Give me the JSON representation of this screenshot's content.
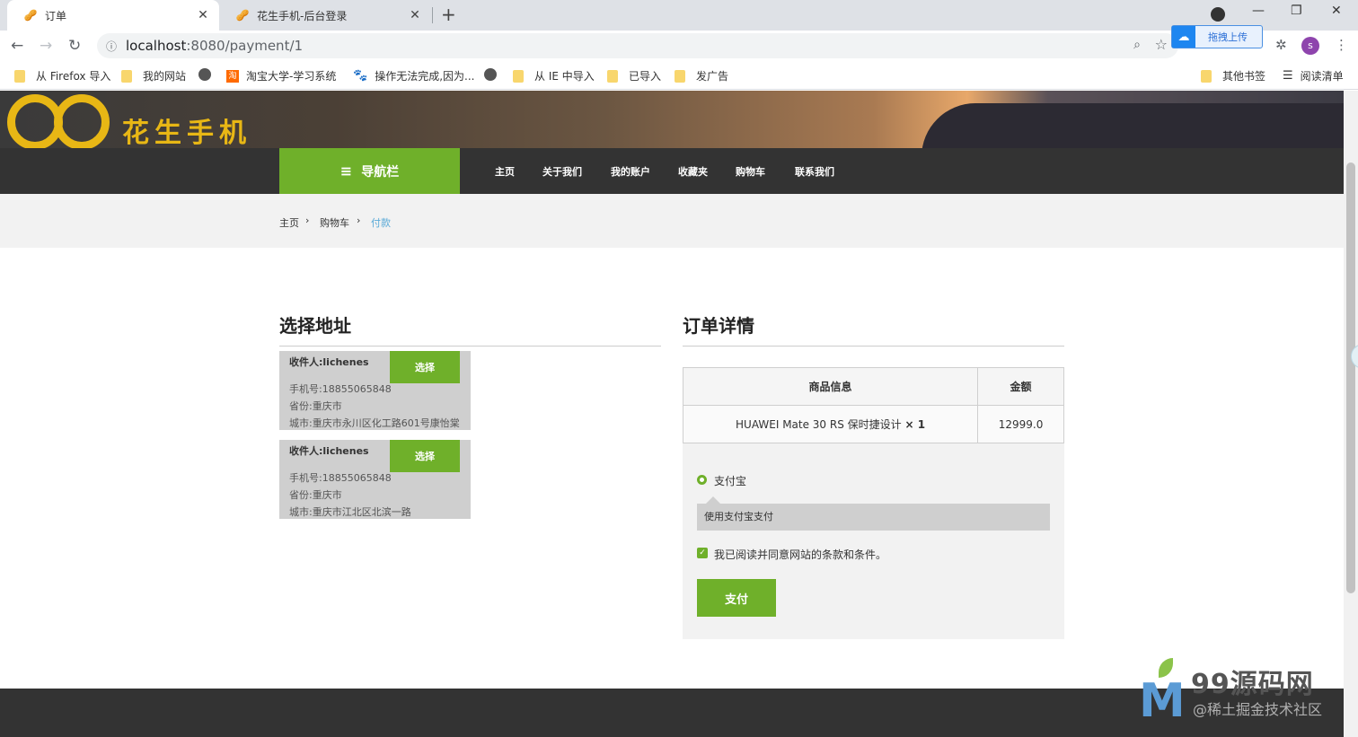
{
  "browser": {
    "tabs": [
      {
        "title": "订单",
        "active": true,
        "favicon": "peanut-favicon-icon"
      },
      {
        "title": "花生手机-后台登录",
        "active": false,
        "favicon": "peanut-favicon-icon"
      }
    ],
    "url_host": "localhost",
    "url_rest": ":8080/payment/1",
    "extension_badge": "拖拽上传",
    "profile_initial": "s",
    "bookmarks": [
      {
        "label": "从 Firefox 导入",
        "icon": "folder-icon"
      },
      {
        "label": "我的网站",
        "icon": "folder-icon"
      },
      {
        "label": "",
        "icon": "globe-icon"
      },
      {
        "label": "淘宝大学-学习系统",
        "icon": "taobao-icon"
      },
      {
        "label": "操作无法完成,因为...",
        "icon": "baidu-icon"
      },
      {
        "label": "",
        "icon": "globe-icon"
      },
      {
        "label": "从 IE 中导入",
        "icon": "folder-icon"
      },
      {
        "label": "已导入",
        "icon": "folder-icon"
      },
      {
        "label": "发广告",
        "icon": "folder-icon"
      }
    ],
    "other_bookmarks": "其他书签",
    "reading_list": "阅读清单"
  },
  "site": {
    "logo_text": "花生手机",
    "nav": {
      "category_label": "导航栏",
      "links": [
        "主页",
        "关于我们",
        "我的账户",
        "收藏夹",
        "购物车",
        "联系我们"
      ]
    },
    "breadcrumb": [
      "主页",
      "购物车",
      "付款"
    ]
  },
  "address": {
    "title": "选择地址",
    "select_label": "选择",
    "cards": [
      {
        "name": "收件人:lichenes",
        "phone": "手机号:18855065848",
        "province": "省份:重庆市",
        "city": "城市:重庆市永川区化工路601号康怡棠"
      },
      {
        "name": "收件人:lichenes",
        "phone": "手机号:18855065848",
        "province": "省份:重庆市",
        "city": "城市:重庆市江北区北滨一路"
      }
    ]
  },
  "order": {
    "title": "订单详情",
    "columns": [
      "商品信息",
      "金额"
    ],
    "rows": [
      {
        "product": "HUAWEI Mate 30 RS 保时捷设计",
        "qty": "× 1",
        "amount": "12999.0"
      }
    ],
    "payment_method": "支付宝",
    "payment_desc": "使用支付宝支付",
    "agree_text": "我已阅读并同意网站的条款和条件。",
    "pay_button": "支付"
  },
  "watermark": {
    "title": "99源码网",
    "subtitle": "@稀土掘金技术社区"
  },
  "colors": {
    "accent_green": "#6fb02a",
    "nav_dark": "#333333",
    "breadcrumb_current": "#5aaad7",
    "logo_gold": "#e8b715"
  }
}
